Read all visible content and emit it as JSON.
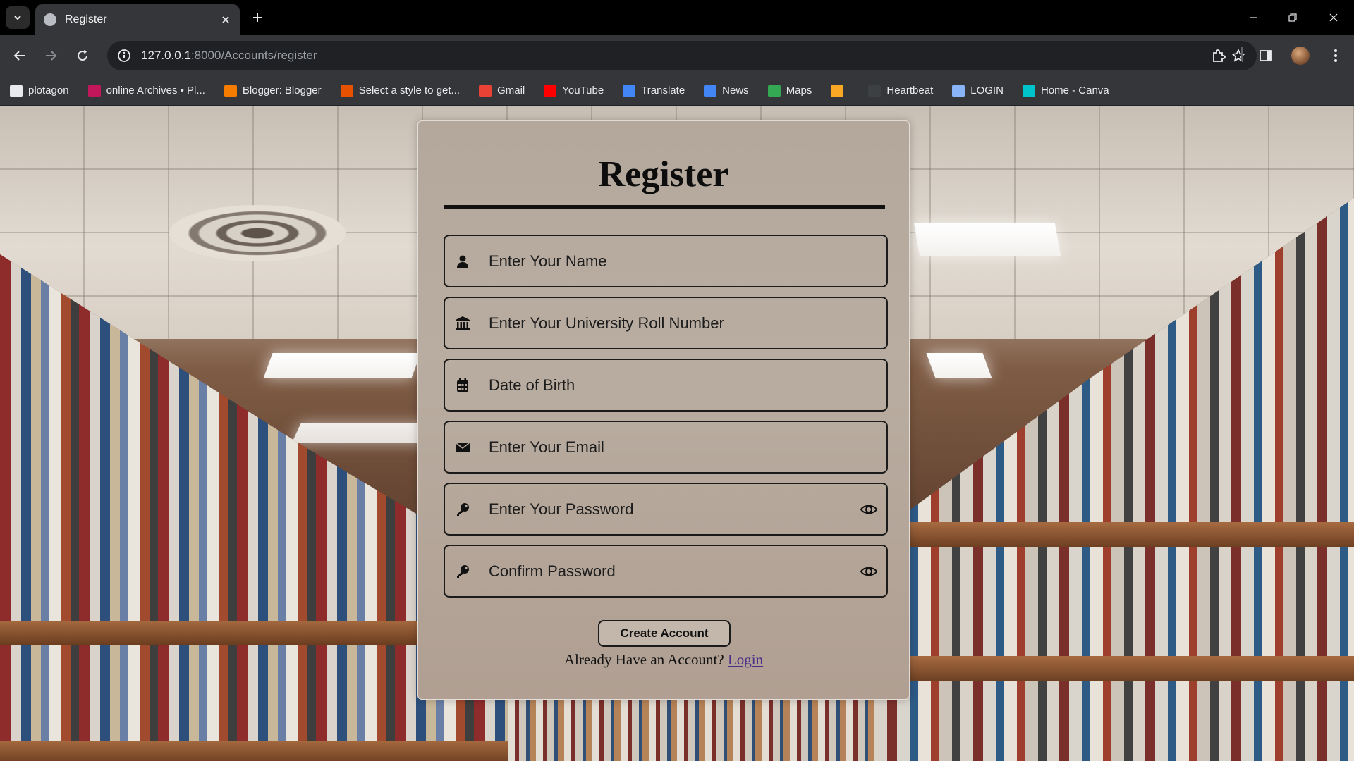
{
  "browser": {
    "tab_title": "Register",
    "url_host": "127.0.0.1",
    "url_path": ":8000/Accounts/register",
    "bookmarks": [
      {
        "label": "plotagon",
        "color": "#e8eaed"
      },
      {
        "label": "online Archives • Pl...",
        "color": "#c2185b"
      },
      {
        "label": "Blogger: Blogger",
        "color": "#f57c00"
      },
      {
        "label": "Select a style to get...",
        "color": "#e65100"
      },
      {
        "label": "Gmail",
        "color": "#ea4335"
      },
      {
        "label": "YouTube",
        "color": "#ff0000"
      },
      {
        "label": "Translate",
        "color": "#4285f4"
      },
      {
        "label": "News",
        "color": "#4285f4"
      },
      {
        "label": "Maps",
        "color": "#34a853"
      },
      {
        "label": "",
        "color": "#f9a825"
      },
      {
        "label": "Heartbeat",
        "color": "#3c4043"
      },
      {
        "label": "LOGIN",
        "color": "#8ab4f8"
      },
      {
        "label": "Home - Canva",
        "color": "#00c4cc"
      }
    ]
  },
  "form": {
    "title": "Register",
    "fields": [
      {
        "placeholder": "Enter Your Name",
        "icon": "user-icon",
        "has_eye": false
      },
      {
        "placeholder": "Enter Your University Roll Number",
        "icon": "university-icon",
        "has_eye": false
      },
      {
        "placeholder": "Date of Birth",
        "icon": "calendar-icon",
        "has_eye": false
      },
      {
        "placeholder": "Enter Your Email",
        "icon": "envelope-icon",
        "has_eye": false
      },
      {
        "placeholder": "Enter Your Password",
        "icon": "key-icon",
        "has_eye": true
      },
      {
        "placeholder": "Confirm Password",
        "icon": "key-icon",
        "has_eye": true
      }
    ],
    "submit_label": "Create Account",
    "footer_text": "Already Have an Account?",
    "login_link": "Login"
  }
}
